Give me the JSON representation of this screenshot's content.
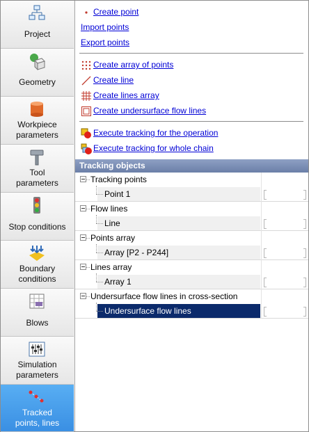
{
  "sidebar": {
    "items": [
      {
        "label": "Project",
        "icon": "project-tree-icon"
      },
      {
        "label": "Geometry",
        "icon": "geometry-cube-icon"
      },
      {
        "label": "Workpiece\nparameters",
        "icon": "workpiece-cylinder-icon"
      },
      {
        "label": "Tool\nparameters",
        "icon": "tool-hammer-icon"
      },
      {
        "label": "Stop conditions",
        "icon": "traffic-light-icon"
      },
      {
        "label": "Boundary\nconditions",
        "icon": "boundary-arrows-icon"
      },
      {
        "label": "Blows",
        "icon": "blows-chart-icon"
      },
      {
        "label": "Simulation\nparameters",
        "icon": "sliders-icon"
      },
      {
        "label": "Tracked\npoints, lines",
        "icon": "tracked-points-icon",
        "active": true
      }
    ]
  },
  "actions": {
    "create_point": "Create point",
    "import_points": "Import points",
    "export_points": "Export points",
    "create_array_points": "Create array of points",
    "create_line": "Create line",
    "create_lines_array": "Create lines array",
    "create_undersurface": "Create undersurface flow lines",
    "exec_operation": "Execute tracking for the operation",
    "exec_chain": "Execute tracking for whole chain"
  },
  "tracking": {
    "header": "Tracking objects",
    "groups": [
      {
        "label": "Tracking points",
        "child": "Point 1"
      },
      {
        "label": "Flow lines",
        "child": "Line"
      },
      {
        "label": "Points array",
        "child": "Array [P2 - P244]"
      },
      {
        "label": "Lines array",
        "child": "Array 1"
      },
      {
        "label": "Undersurface flow lines in cross-section",
        "child": "Undersurface flow lines",
        "selected": true
      }
    ]
  },
  "colors": {
    "accent": "#3a8fe3",
    "link": "#0000d6",
    "header": "#6b7fa8",
    "selection": "#0b2a6b"
  }
}
